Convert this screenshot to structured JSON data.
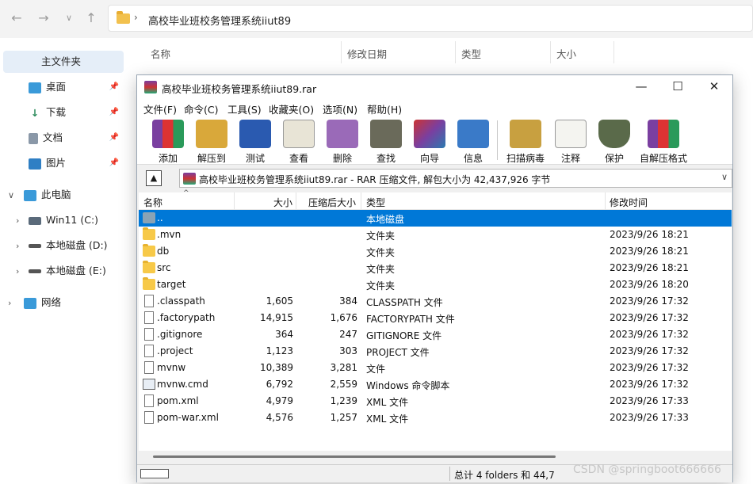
{
  "explorer": {
    "address": "高校毕业班校务管理系统iiut89",
    "sidebar": {
      "home": "主文件夹",
      "desktop": "桌面",
      "downloads": "下载",
      "documents": "文档",
      "pictures": "图片",
      "this_pc": "此电脑",
      "drive_c": "Win11 (C:)",
      "drive_d": "本地磁盘 (D:)",
      "drive_e": "本地磁盘 (E:)",
      "network": "网络"
    },
    "headers": {
      "name": "名称",
      "modified": "修改日期",
      "type": "类型",
      "size": "大小"
    }
  },
  "rar": {
    "title": "高校毕业班校务管理系统iiut89.rar",
    "menu": [
      "文件(F)",
      "命令(C)",
      "工具(S)",
      "收藏夹(O)",
      "选项(N)",
      "帮助(H)"
    ],
    "toolbar": [
      "添加",
      "解压到",
      "测试",
      "查看",
      "删除",
      "查找",
      "向导",
      "信息",
      "扫描病毒",
      "注释",
      "保护",
      "自解压格式"
    ],
    "path": "高校毕业班校务管理系统iiut89.rar - RAR 压缩文件, 解包大小为 42,437,926 字节",
    "columns": {
      "name": "名称",
      "size": "大小",
      "packed": "压缩后大小",
      "type": "类型",
      "modified": "修改时间"
    },
    "rows": [
      {
        "name": "..",
        "size": "",
        "packed": "",
        "type": "本地磁盘",
        "modified": "",
        "icon": "up-folder"
      },
      {
        "name": ".mvn",
        "size": "",
        "packed": "",
        "type": "文件夹",
        "modified": "2023/9/26 18:21",
        "icon": "folder"
      },
      {
        "name": "db",
        "size": "",
        "packed": "",
        "type": "文件夹",
        "modified": "2023/9/26 18:21",
        "icon": "folder"
      },
      {
        "name": "src",
        "size": "",
        "packed": "",
        "type": "文件夹",
        "modified": "2023/9/26 18:21",
        "icon": "folder"
      },
      {
        "name": "target",
        "size": "",
        "packed": "",
        "type": "文件夹",
        "modified": "2023/9/26 18:20",
        "icon": "folder"
      },
      {
        "name": ".classpath",
        "size": "1,605",
        "packed": "384",
        "type": "CLASSPATH 文件",
        "modified": "2023/9/26 17:32",
        "icon": "file"
      },
      {
        "name": ".factorypath",
        "size": "14,915",
        "packed": "1,676",
        "type": "FACTORYPATH 文件",
        "modified": "2023/9/26 17:32",
        "icon": "file"
      },
      {
        "name": ".gitignore",
        "size": "364",
        "packed": "247",
        "type": "GITIGNORE 文件",
        "modified": "2023/9/26 17:32",
        "icon": "file"
      },
      {
        "name": ".project",
        "size": "1,123",
        "packed": "303",
        "type": "PROJECT 文件",
        "modified": "2023/9/26 17:32",
        "icon": "file"
      },
      {
        "name": "mvnw",
        "size": "10,389",
        "packed": "3,281",
        "type": "文件",
        "modified": "2023/9/26 17:32",
        "icon": "file"
      },
      {
        "name": "mvnw.cmd",
        "size": "6,792",
        "packed": "2,559",
        "type": "Windows 命令脚本",
        "modified": "2023/9/26 17:32",
        "icon": "cmd"
      },
      {
        "name": "pom.xml",
        "size": "4,979",
        "packed": "1,239",
        "type": "XML 文件",
        "modified": "2023/9/26 17:33",
        "icon": "file"
      },
      {
        "name": "pom-war.xml",
        "size": "4,576",
        "packed": "1,257",
        "type": "XML 文件",
        "modified": "2023/9/26 17:33",
        "icon": "file"
      }
    ],
    "status": "总计 4 folders 和 44,7",
    "watermark": "CSDN @springboot666666"
  }
}
